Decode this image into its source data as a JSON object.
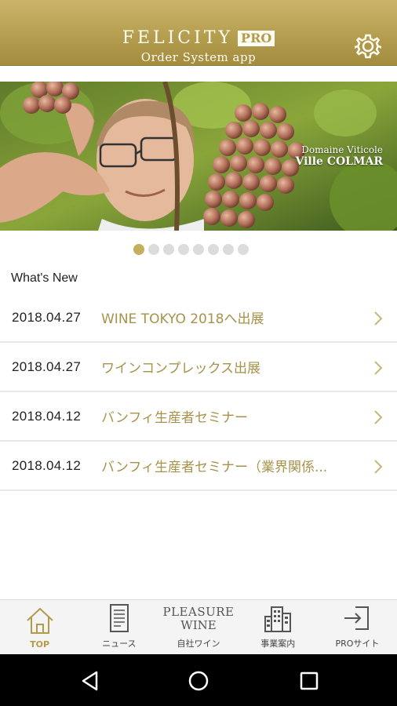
{
  "header": {
    "brand": "FELICITY",
    "brand_badge": "PRO",
    "subtitle": "Order System app",
    "settings_icon": "gear-icon",
    "bg_color": "#b59e4f"
  },
  "banner": {
    "caption_line1": "Domaine Viticole",
    "caption_line2": "Ville COLMAR",
    "slide_count": 8,
    "active_slide": 1
  },
  "news": {
    "section_title": "What's New",
    "items": [
      {
        "date": "2018.04.27",
        "title": "WINE TOKYO 2018へ出展"
      },
      {
        "date": "2018.04.27",
        "title": "ワインコンプレックス出展"
      },
      {
        "date": "2018.04.12",
        "title": "バンフィ生産者セミナー"
      },
      {
        "date": "2018.04.12",
        "title": "バンフィ生産者セミナー（業界関係..."
      }
    ],
    "title_color": "#a8924a"
  },
  "tabbar": {
    "tabs": [
      {
        "label": "TOP",
        "icon": "home-icon",
        "active": true
      },
      {
        "label": "ニュース",
        "icon": "document-icon",
        "active": false
      },
      {
        "label": "自社ワイン",
        "wordmark1": "PLEASURE",
        "wordmark2": "WINE",
        "active": false
      },
      {
        "label": "事業案内",
        "icon": "building-icon",
        "active": false
      },
      {
        "label": "PROサイト",
        "icon": "login-icon",
        "active": false
      }
    ],
    "accent_color": "#b39b4a"
  },
  "system_nav": {
    "back_icon": "back-triangle-icon",
    "home_icon": "home-circle-icon",
    "recents_icon": "recents-square-icon"
  }
}
